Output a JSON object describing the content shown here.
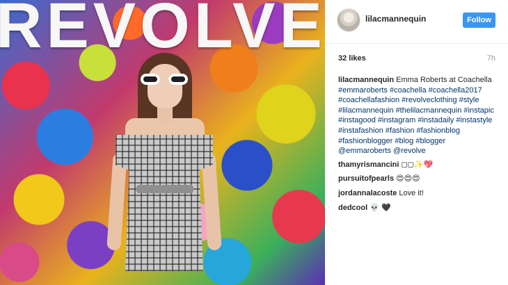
{
  "photo": {
    "brand_text": "REVOLVE"
  },
  "post": {
    "username": "lilacmannequin",
    "follow_label": "Follow",
    "likes": "32 likes",
    "time": "7h",
    "caption": {
      "user": "lilacmannequin",
      "text": "Emma Roberts at Coachella",
      "tags": [
        "#emmaroberts",
        "#coachella",
        "#coachella2017",
        "#coachellafashion",
        "#revolveclothing",
        "#style",
        "#lilacmannequin",
        "#thelilacmannequin",
        "#instapic",
        "#instagood",
        "#instagram",
        "#instadaily",
        "#instastyle",
        "#instafashion",
        "#fashion",
        "#fashionblog",
        "#fashionblogger",
        "#blog",
        "#blogger",
        "@emmaroberts",
        "@revolve"
      ]
    },
    "comments": [
      {
        "user": "thamyrismancini",
        "text": "◻◻✨💖"
      },
      {
        "user": "pursuitofpearls",
        "text": "😍😍😍"
      },
      {
        "user": "jordannalacoste",
        "text": "Love it!"
      },
      {
        "user": "dedcool",
        "text": "💀 🖤"
      }
    ]
  },
  "colors": {
    "accent": "#3897f0",
    "link": "#003569",
    "text": "#262626",
    "muted": "#999999"
  }
}
